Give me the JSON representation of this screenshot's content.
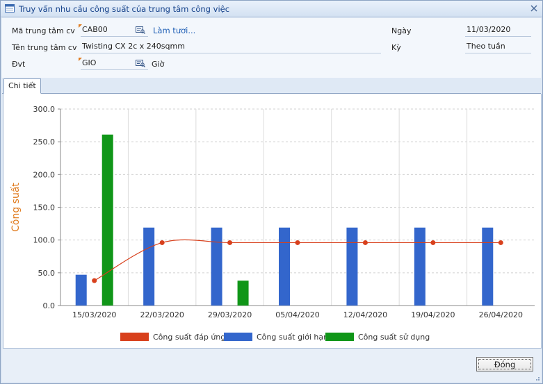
{
  "window": {
    "title": "Truy vấn nhu cầu công suất của trung tâm công việc",
    "icon": "form-icon"
  },
  "header": {
    "ma_ttcv_label": "Mã trung tâm cv",
    "ma_ttcv_value": "CAB00",
    "refresh_link": "Làm tươi...",
    "ten_ttcv_label": "Tên trung tâm cv",
    "ten_ttcv_value": "Twisting CX 2c x 240sqmm",
    "dvt_label": "Đvt",
    "dvt_value": "GIO",
    "dvt_name": "Giờ",
    "ngay_label": "Ngày",
    "ngay_value": "11/03/2020",
    "ky_label": "Kỳ",
    "ky_value": "Theo tuần"
  },
  "tabs": [
    "Chi tiết"
  ],
  "chart_data": {
    "type": "bar",
    "categories": [
      "15/03/2020",
      "22/03/2020",
      "29/03/2020",
      "05/04/2020",
      "12/04/2020",
      "19/04/2020",
      "26/04/2020"
    ],
    "ylabel": "Công suất",
    "ylim": [
      0,
      300
    ],
    "yticks": [
      "0.0",
      "50.0",
      "100.0",
      "150.0",
      "200.0",
      "250.0",
      "300.0"
    ],
    "grid": true,
    "legend_position": "bottom",
    "series": [
      {
        "name": "Công suất đáp ứng",
        "type": "line",
        "color": "#d8401c",
        "values": [
          38,
          96,
          96,
          96,
          96,
          96,
          96
        ]
      },
      {
        "name": "Công suất giới hạn",
        "type": "bar",
        "color": "#3366cc",
        "values": [
          47,
          119,
          119,
          119,
          119,
          119,
          119
        ]
      },
      {
        "name": "Công suất sử dụng",
        "type": "bar",
        "color": "#109618",
        "values": [
          261,
          null,
          38,
          null,
          null,
          null,
          null
        ]
      }
    ]
  },
  "footer": {
    "close_button": "Đóng"
  }
}
